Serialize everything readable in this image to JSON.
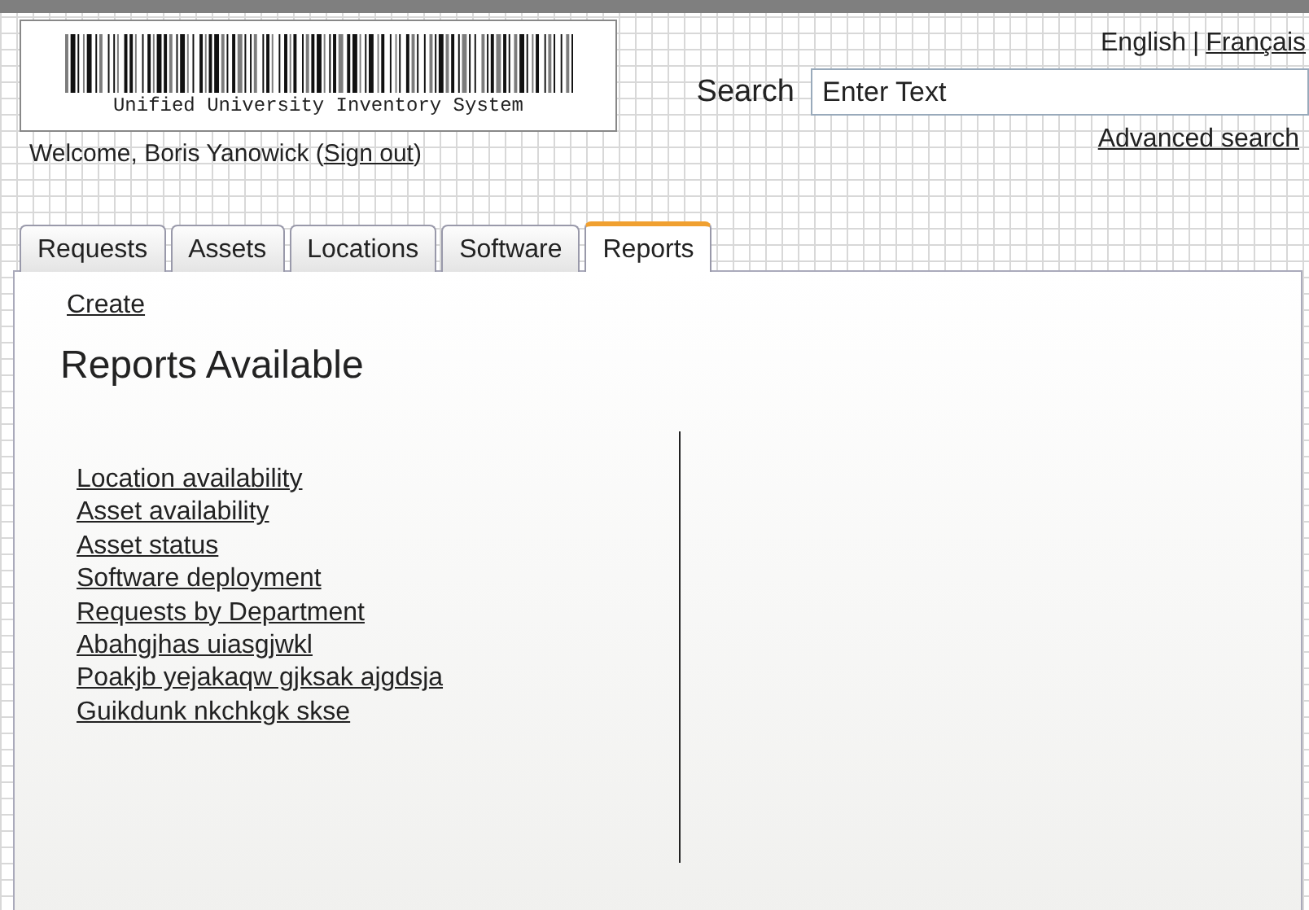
{
  "logo": {
    "caption": "Unified University Inventory System"
  },
  "welcome": {
    "before": "Welcome, Boris Yanowick (",
    "link": "Sign out",
    "after": ")"
  },
  "languages": {
    "separator": "|",
    "items": [
      {
        "label": "English",
        "selected": true
      },
      {
        "label": "Français",
        "selected": false
      }
    ]
  },
  "search": {
    "label": "Search",
    "value": "Enter Text",
    "advanced_link": "Advanced search"
  },
  "tabs": [
    {
      "label": "Requests",
      "selected": false
    },
    {
      "label": "Assets",
      "selected": false
    },
    {
      "label": "Locations",
      "selected": false
    },
    {
      "label": "Software",
      "selected": false
    },
    {
      "label": "Reports",
      "selected": true
    }
  ],
  "create_link": "Create",
  "heading": "Reports Available",
  "reports": [
    "Location availability",
    "Asset availability",
    "Asset status",
    "Software deployment",
    "Requests by Department",
    "Abahgjhas uiasgjwkl",
    "Poakjb yejakaqw gjksak ajgdsja",
    "Guikdunk nkchkgk skse"
  ]
}
